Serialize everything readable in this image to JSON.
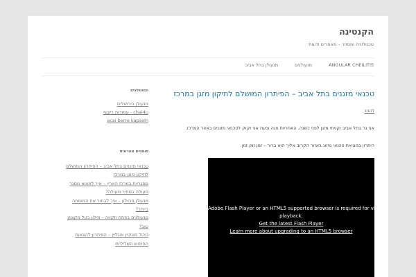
{
  "site": {
    "title": "הקנטינה",
    "description": "טכנולוגיה ומסחר – מאמרים ודעות"
  },
  "nav": {
    "items": [
      "מנעולן בתל אביב",
      "מנעולנים",
      "ANGULAR CHEILITIS"
    ]
  },
  "post": {
    "title": "טכנאי מזגנים בתל אביב – הפיתרון המושלם לתיקון מזגן במרכז",
    "link": "להגיב",
    "paragraph1": "אני גר בתל אביב וקניתי מזגן לפני כשנה. האחריות פגה וכעת אני זקוק לטכנאי מזגנים באזור המרכז.",
    "paragraph2": "היתרון במציאת טכנאי מיזוג באזור הקרוב אליך הוא ברור – זמן זמן זמן."
  },
  "video": {
    "line1": "Adobe Flash Player or an HTML5 supported browser is required for video",
    "line2": "playback.",
    "link1": "Get the latest Flash Player",
    "link2": "Learn more about upgrading to an HTML5 browser"
  },
  "sidebar": {
    "widget1": {
      "title": "המומלצים",
      "items": [
        "מנעולן בירושלים",
        "chai4u - עמודות ריצוף",
        "acai berre kapseln"
      ]
    },
    "widget2": {
      "title": "פוסטים אחרונים",
      "items": [
        "טכנאי מזגנים בתל אביב – הפיתרון המושלם",
        "לתיקון מזגן במרכז",
        "מסגריות במרכז הארץ – איך למצוא מסגר",
        "מעולה במחיר מעולה?",
        "מנעולן מהולון – איך לבחור את המומחה",
        "ביותר?",
        "מנעולנים בפתח תקווה – מילון בעל מקצוע",
        "טוב?",
        "ניהול מוניטין אונליין – הפיתרון להצאות",
        "החיפוש השליליות"
      ]
    }
  }
}
